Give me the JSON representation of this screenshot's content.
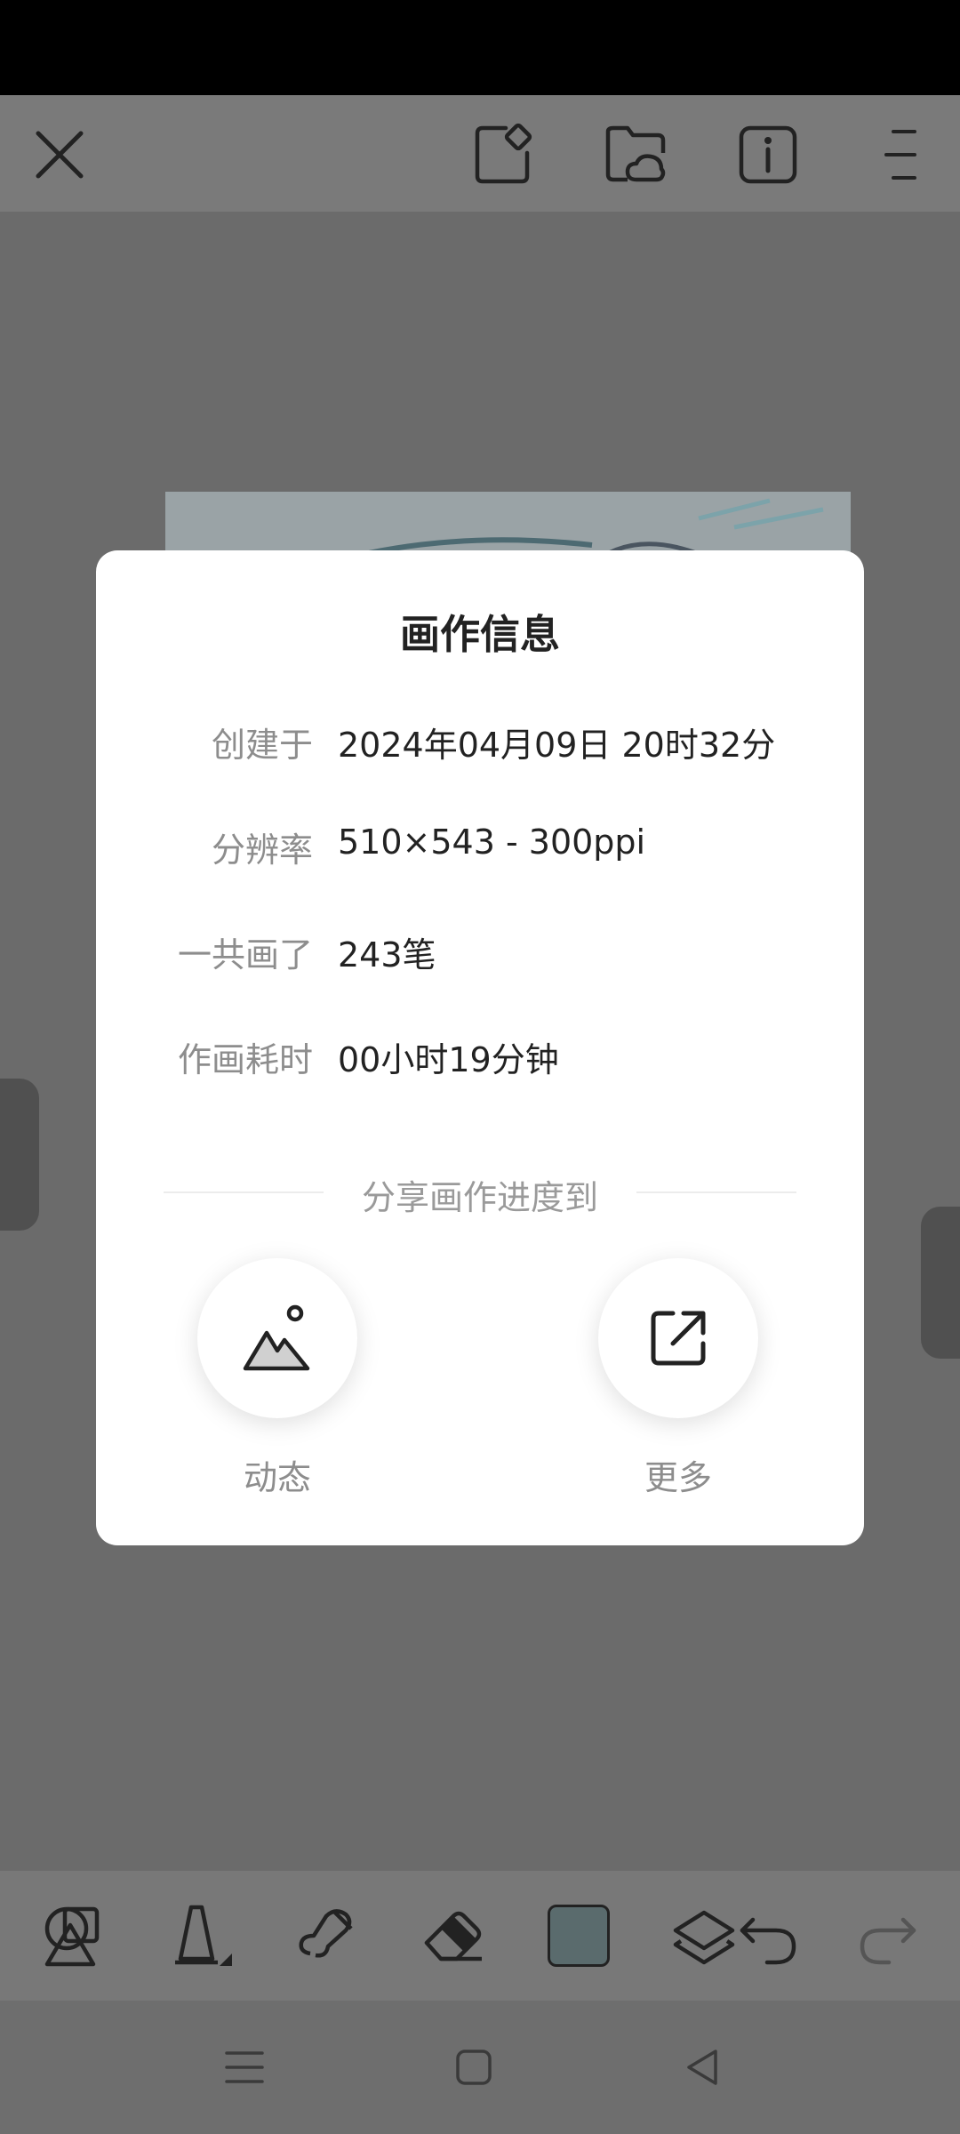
{
  "topbar": {
    "close_icon": "close-icon",
    "edit_icon": "edit-note-icon",
    "cloud_folder_icon": "cloud-folder-icon",
    "info_icon": "info-icon",
    "menu_icon": "menu-icon"
  },
  "dialog": {
    "title": "画作信息",
    "rows": [
      {
        "label": "创建于",
        "value": "2024年04月09日 20时32分"
      },
      {
        "label": "分辨率",
        "value": "510×543 - 300ppi"
      },
      {
        "label": "一共画了",
        "value": "243笔"
      },
      {
        "label": "作画耗时",
        "value": "00小时19分钟"
      }
    ],
    "share_heading": "分享画作进度到",
    "share_options": [
      {
        "label": "动态",
        "icon": "image-mountain-icon"
      },
      {
        "label": "更多",
        "icon": "share-external-icon"
      }
    ]
  },
  "toolbar": {
    "tools": [
      "shapes-icon",
      "brush-icon",
      "smudge-icon",
      "eraser-icon",
      "color-swatch",
      "layers-icon",
      "undo-icon",
      "redo-icon"
    ],
    "current_color": "#5a6b6d"
  },
  "navbar": {
    "buttons": [
      "recents-icon",
      "home-icon",
      "back-icon"
    ]
  }
}
